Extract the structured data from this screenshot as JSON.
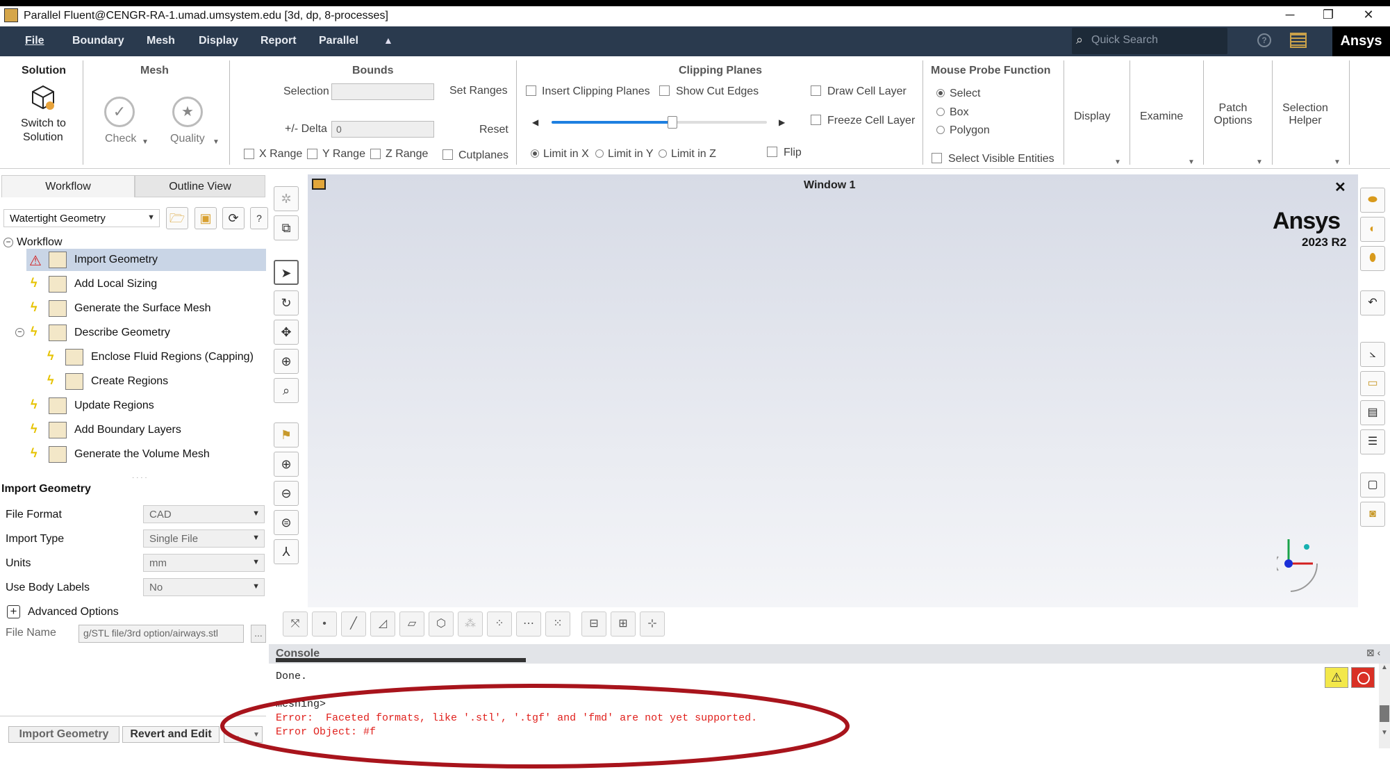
{
  "window": {
    "title": "Parallel Fluent@CENGR-RA-1.umad.umsystem.edu  [3d, dp, 8-processes]",
    "min": "─",
    "max": "❐",
    "close": "✕"
  },
  "menubar": {
    "items": [
      "File",
      "Boundary",
      "Mesh",
      "Display",
      "Report",
      "Parallel"
    ],
    "search_placeholder": "Quick Search",
    "brand": "Ansys"
  },
  "ribbon": {
    "solution": {
      "title": "Solution",
      "switch_label_1": "Switch to",
      "switch_label_2": "Solution"
    },
    "mesh": {
      "title": "Mesh",
      "check": "Check",
      "quality": "Quality"
    },
    "bounds": {
      "title": "Bounds",
      "selection": "Selection",
      "set_ranges": "Set Ranges",
      "delta": "+/- Delta",
      "delta_value": "0",
      "reset": "Reset",
      "x_range": "X Range",
      "y_range": "Y Range",
      "z_range": "Z Range",
      "cutplanes": "Cutplanes"
    },
    "clipping": {
      "title": "Clipping Planes",
      "insert": "Insert Clipping Planes",
      "show_cut_edges": "Show Cut Edges",
      "draw_cell_layer": "Draw Cell Layer",
      "freeze_cell_layer": "Freeze Cell Layer",
      "limit_x": "Limit in X",
      "limit_y": "Limit in Y",
      "limit_z": "Limit in Z",
      "flip": "Flip",
      "slider_level": 0.56
    },
    "probe": {
      "title": "Mouse Probe Function",
      "select": "Select",
      "box": "Box",
      "polygon": "Polygon",
      "visible": "Select Visible Entities"
    },
    "display": "Display",
    "examine": "Examine",
    "patch_1": "Patch",
    "patch_2": "Options",
    "selhelper_1": "Selection",
    "selhelper_2": "Helper"
  },
  "left": {
    "tabs": [
      "Workflow",
      "Outline View"
    ],
    "workflow_select": "Watertight Geometry",
    "tree_root": "Workflow",
    "tree": [
      {
        "label": "Import Geometry",
        "status": "error",
        "indent": 0
      },
      {
        "label": "Add Local Sizing",
        "status": "pending",
        "indent": 0
      },
      {
        "label": "Generate the Surface Mesh",
        "status": "pending",
        "indent": 0
      },
      {
        "label": "Describe Geometry",
        "status": "pending",
        "indent": 0
      },
      {
        "label": "Enclose Fluid Regions (Capping)",
        "status": "pending",
        "indent": 1
      },
      {
        "label": "Create Regions",
        "status": "pending",
        "indent": 1
      },
      {
        "label": "Update Regions",
        "status": "pending",
        "indent": 0
      },
      {
        "label": "Add Boundary Layers",
        "status": "pending",
        "indent": 0
      },
      {
        "label": "Generate the Volume Mesh",
        "status": "pending",
        "indent": 0
      }
    ],
    "section_title": "Import Geometry",
    "props": [
      {
        "label": "File Format",
        "value": "CAD"
      },
      {
        "label": "Import Type",
        "value": "Single File"
      },
      {
        "label": "Units",
        "value": "mm"
      },
      {
        "label": "Use Body Labels",
        "value": "No"
      }
    ],
    "advanced": "Advanced Options",
    "file_name_label": "File Name",
    "file_name_value": "g/STL file/3rd option/airways.stl",
    "browse": "...",
    "btn_import": "Import Geometry",
    "btn_revert": "Revert and Edit",
    "btn_more": "..."
  },
  "graphics": {
    "title": "Window 1",
    "logo": "Ansys",
    "version": "2023 R2",
    "close": "✕"
  },
  "console": {
    "title": "Console",
    "lines": [
      {
        "text": "Done.",
        "type": "normal"
      },
      {
        "text": "",
        "type": "normal"
      },
      {
        "text": "meshing>",
        "type": "normal"
      },
      {
        "text": "Error:  Faceted formats, like '.stl', '.tgf' and 'fmd' are not yet supported.",
        "type": "error"
      },
      {
        "text": "Error Object: #f",
        "type": "error"
      }
    ],
    "warning_icon": "⚠"
  },
  "colors": {
    "menubar": "#2a3a4e",
    "error_text": "#e0201c",
    "annotation": "#a8141c",
    "selected_row": "#c9d5e6"
  }
}
